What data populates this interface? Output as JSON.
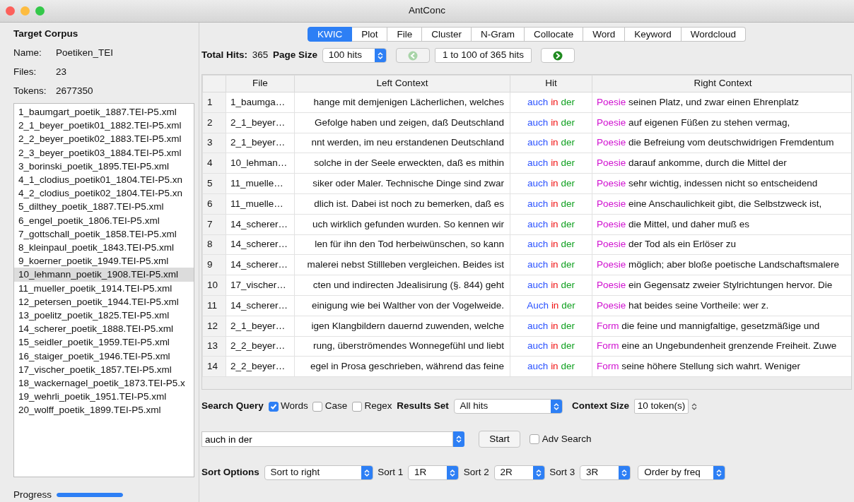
{
  "window": {
    "title": "AntConc"
  },
  "corpus": {
    "heading": "Target Corpus",
    "fields": [
      {
        "label": "Name:",
        "value": "Poetiken_TEI"
      },
      {
        "label": "Files:",
        "value": "23"
      },
      {
        "label": "Tokens:",
        "value": "2677350"
      }
    ],
    "files": [
      {
        "name": "1_baumgart_poetik_1887.TEI-P5.xml",
        "selected": false
      },
      {
        "name": "2_1_beyer_poetik01_1882.TEI-P5.xml",
        "selected": false
      },
      {
        "name": "2_2_beyer_poetik02_1883.TEI-P5.xml",
        "selected": false
      },
      {
        "name": "2_3_beyer_poetik03_1884.TEI-P5.xml",
        "selected": false
      },
      {
        "name": "3_borinski_poetik_1895.TEI-P5.xml",
        "selected": false
      },
      {
        "name": "4_1_clodius_poetik01_1804.TEI-P5.xn",
        "selected": false
      },
      {
        "name": "4_2_clodius_poetik02_1804.TEI-P5.xn",
        "selected": false
      },
      {
        "name": "5_dilthey_poetik_1887.TEI-P5.xml",
        "selected": false
      },
      {
        "name": "6_engel_poetik_1806.TEI-P5.xml",
        "selected": false
      },
      {
        "name": "7_gottschall_poetik_1858.TEI-P5.xml",
        "selected": false
      },
      {
        "name": "8_kleinpaul_poetik_1843.TEI-P5.xml",
        "selected": false
      },
      {
        "name": "9_koerner_poetik_1949.TEI-P5.xml",
        "selected": false
      },
      {
        "name": "10_lehmann_poetik_1908.TEI-P5.xml",
        "selected": true
      },
      {
        "name": "11_mueller_poetik_1914.TEI-P5.xml",
        "selected": false
      },
      {
        "name": "12_petersen_poetik_1944.TEI-P5.xml",
        "selected": false
      },
      {
        "name": "13_poelitz_poetik_1825.TEI-P5.xml",
        "selected": false
      },
      {
        "name": "14_scherer_poetik_1888.TEI-P5.xml",
        "selected": false
      },
      {
        "name": "15_seidler_poetik_1959.TEI-P5.xml",
        "selected": false
      },
      {
        "name": "16_staiger_poetik_1946.TEI-P5.xml",
        "selected": false
      },
      {
        "name": "17_vischer_poetik_1857.TEI-P5.xml",
        "selected": false
      },
      {
        "name": "18_wackernagel_poetik_1873.TEI-P5.x",
        "selected": false
      },
      {
        "name": "19_wehrli_poetik_1951.TEI-P5.xml",
        "selected": false
      },
      {
        "name": "20_wolff_poetik_1899.TEI-P5.xml",
        "selected": false
      }
    ]
  },
  "progress": {
    "label": "Progress",
    "level": 1
  },
  "tabs": [
    {
      "label": "KWIC",
      "selected": true
    },
    {
      "label": "Plot",
      "selected": false
    },
    {
      "label": "File",
      "selected": false
    },
    {
      "label": "Cluster",
      "selected": false
    },
    {
      "label": "N-Gram",
      "selected": false
    },
    {
      "label": "Collocate",
      "selected": false
    },
    {
      "label": "Word",
      "selected": false
    },
    {
      "label": "Keyword",
      "selected": false
    },
    {
      "label": "Wordcloud",
      "selected": false
    }
  ],
  "hits": {
    "total_label": "Total Hits:",
    "total": "365",
    "page_size_label": "Page Size",
    "page_size": "100 hits",
    "range": "1 to 100 of 365 hits",
    "prev_disabled": true,
    "next_disabled": false
  },
  "table": {
    "columns": [
      "File",
      "Left Context",
      "Hit",
      "Right Context"
    ],
    "rows": [
      {
        "n": "1",
        "file": "1_baumga…",
        "left": "hange mit demjenigen Lächerlichen, welches",
        "hit": [
          "auch",
          "in",
          "der"
        ],
        "key": "Poesie",
        "right": "seinen Platz, und zwar einen Ehrenplatz"
      },
      {
        "n": "2",
        "file": "2_1_beyer…",
        "left": "Gefolge haben und zeigen, daß Deutschland",
        "hit": [
          "auch",
          "in",
          "der"
        ],
        "key": "Poesie",
        "right": "auf eigenen Füßen zu stehen vermag,"
      },
      {
        "n": "3",
        "file": "2_1_beyer…",
        "left": "nnt werden, im neu erstandenen Deutschland",
        "hit": [
          "auch",
          "in",
          "der"
        ],
        "key": "Poesie",
        "right": "die Befreiung vom deutschwidrigen Fremdentum"
      },
      {
        "n": "4",
        "file": "10_lehman…",
        "left": "solche in der Seele erweckten, daß es mithin",
        "hit": [
          "auch",
          "in",
          "der"
        ],
        "key": "Poesie",
        "right": "darauf ankomme, durch die Mittel der"
      },
      {
        "n": "5",
        "file": "11_muelle…",
        "left": "siker oder Maler. Technische Dinge sind zwar",
        "hit": [
          "auch",
          "in",
          "der"
        ],
        "key": "Poesie",
        "right": "sehr wichtig, indessen nicht so entscheidend"
      },
      {
        "n": "6",
        "file": "11_muelle…",
        "left": "dlich ist. Dabei ist noch zu bemerken, daß es",
        "hit": [
          "auch",
          "in",
          "der"
        ],
        "key": "Poesie",
        "right": "eine Anschaulichkeit gibt, die Selbstzweck ist,"
      },
      {
        "n": "7",
        "file": "14_scherer…",
        "left": "uch wirklich gefunden wurden. So kennen wir",
        "hit": [
          "auch",
          "in",
          "der"
        ],
        "key": "Poesie",
        "right": "die Mittel, und daher muß es"
      },
      {
        "n": "8",
        "file": "14_scherer…",
        "left": "len für ihn den Tod herbeiwünschen, so kann",
        "hit": [
          "auch",
          "in",
          "der"
        ],
        "key": "Poesie",
        "right": "der Tod als ein Erlöser zu"
      },
      {
        "n": "9",
        "file": "14_scherer…",
        "left": "malerei nebst Stillleben vergleichen. Beides ist",
        "hit": [
          "auch",
          "in",
          "der"
        ],
        "key": "Poesie",
        "right": "möglich; aber bloße poetische Landschaftsmalere"
      },
      {
        "n": "10",
        "file": "17_vischer…",
        "left": "cten und indirecten Jdealisirung (§. 844) geht",
        "hit": [
          "auch",
          "in",
          "der"
        ],
        "key": "Poesie",
        "right": "ein Gegensatz zweier Stylrichtungen hervor. Die"
      },
      {
        "n": "11",
        "file": "14_scherer…",
        "left": "einigung wie bei Walther von der Vogelweide.",
        "hit": [
          "Auch",
          "in",
          "der"
        ],
        "key": "Poesie",
        "right": "hat beides seine Vortheile: wer z."
      },
      {
        "n": "12",
        "file": "2_1_beyer…",
        "left": "igen Klangbildern dauernd zuwenden, welche",
        "hit": [
          "auch",
          "in",
          "der"
        ],
        "key": "Form",
        "right": "die feine und mannigfaltige, gesetzmäßige und"
      },
      {
        "n": "13",
        "file": "2_2_beyer…",
        "left": "rung, überströmendes Wonnegefühl und liebt",
        "hit": [
          "auch",
          "in",
          "der"
        ],
        "key": "Form",
        "right": "eine an Ungebundenheit grenzende Freiheit. Zuwe"
      },
      {
        "n": "14",
        "file": "2_2_beyer…",
        "left": "egel in Prosa geschrieben, während das feine",
        "hit": [
          "auch",
          "in",
          "der"
        ],
        "key": "Form",
        "right": "seine höhere Stellung sich wahrt. Weniger"
      }
    ]
  },
  "search": {
    "label": "Search Query",
    "options": [
      {
        "label": "Words",
        "checked": true
      },
      {
        "label": "Case",
        "checked": false
      },
      {
        "label": "Regex",
        "checked": false
      }
    ],
    "results_label": "Results Set",
    "results": "All hits",
    "context_label": "Context Size",
    "context": "10 token(s)",
    "query": "auch in der",
    "start": "Start",
    "adv": {
      "label": "Adv Search",
      "checked": false
    }
  },
  "sort": {
    "label": "Sort Options",
    "mode": "Sort to right",
    "levels": [
      {
        "label": "Sort 1",
        "value": "1R"
      },
      {
        "label": "Sort 2",
        "value": "2R"
      },
      {
        "label": "Sort 3",
        "value": "3R"
      }
    ],
    "order": "Order by freq"
  }
}
